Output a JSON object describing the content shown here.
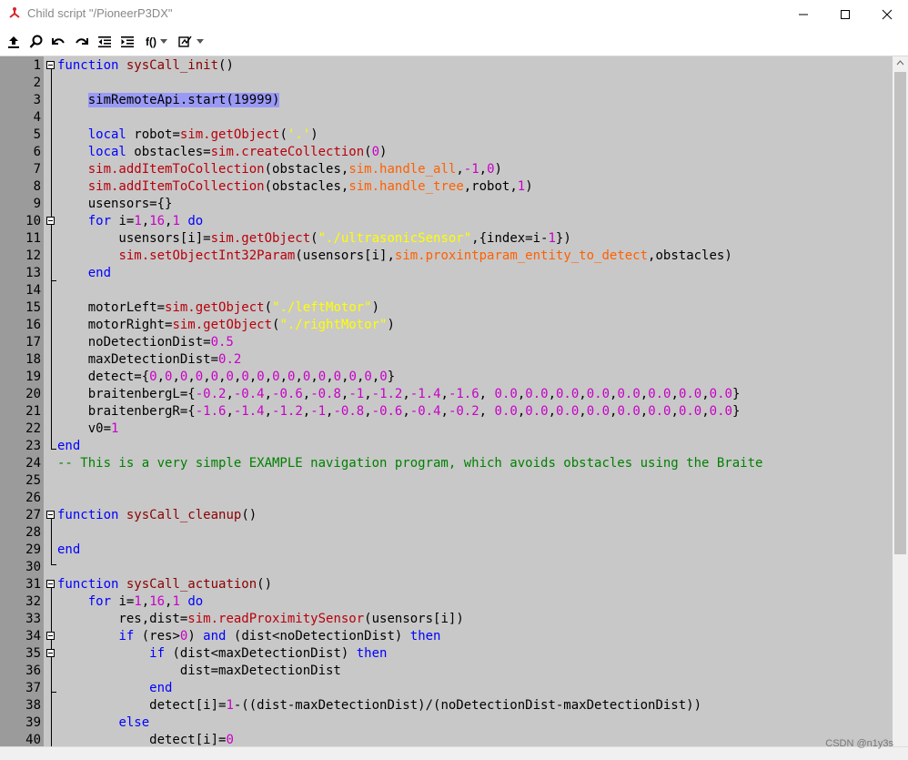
{
  "window": {
    "title": "Child script \"/PioneerP3DX\"",
    "accent_color": "#d8262a"
  },
  "toolbar": {
    "function_label": "f()",
    "items": [
      "upload-icon",
      "search-icon",
      "undo-icon",
      "redo-icon",
      "outdent-icon",
      "indent-icon",
      "function-menu",
      "snippet-menu"
    ]
  },
  "colors": {
    "keyword": "#0000ff",
    "function": "#8b0000",
    "api": "#b8000b",
    "number": "#c800c8",
    "string": "#ffff00",
    "constant": "#ff6000",
    "comment": "#008000",
    "selection": "#9a9af6",
    "gutter": "#9b9b9b",
    "background": "#c8c8c8"
  },
  "lines": [
    {
      "n": "1",
      "tokens": [
        {
          "t": "function",
          "c": "keyword"
        },
        {
          "t": " ",
          "c": "plain"
        },
        {
          "t": "sysCall_init",
          "c": "function"
        },
        {
          "t": "()",
          "c": "plain"
        }
      ]
    },
    {
      "n": "2",
      "tokens": []
    },
    {
      "n": "3",
      "tokens": [
        {
          "t": "    ",
          "c": "plain"
        },
        {
          "t": "simRemoteApi.start(19999)",
          "c": "selected"
        }
      ]
    },
    {
      "n": "4",
      "tokens": []
    },
    {
      "n": "5",
      "tokens": [
        {
          "t": "    ",
          "c": "plain"
        },
        {
          "t": "local",
          "c": "keyword"
        },
        {
          "t": " robot=",
          "c": "plain"
        },
        {
          "t": "sim.getObject",
          "c": "api"
        },
        {
          "t": "(",
          "c": "plain"
        },
        {
          "t": "'.'",
          "c": "string"
        },
        {
          "t": ")",
          "c": "plain"
        }
      ]
    },
    {
      "n": "6",
      "tokens": [
        {
          "t": "    ",
          "c": "plain"
        },
        {
          "t": "local",
          "c": "keyword"
        },
        {
          "t": " obstacles=",
          "c": "plain"
        },
        {
          "t": "sim.createCollection",
          "c": "api"
        },
        {
          "t": "(",
          "c": "plain"
        },
        {
          "t": "0",
          "c": "number"
        },
        {
          "t": ")",
          "c": "plain"
        }
      ]
    },
    {
      "n": "7",
      "tokens": [
        {
          "t": "    ",
          "c": "plain"
        },
        {
          "t": "sim.addItemToCollection",
          "c": "api"
        },
        {
          "t": "(obstacles,",
          "c": "plain"
        },
        {
          "t": "sim.handle_all",
          "c": "constant"
        },
        {
          "t": ",",
          "c": "plain"
        },
        {
          "t": "-1",
          "c": "number"
        },
        {
          "t": ",",
          "c": "plain"
        },
        {
          "t": "0",
          "c": "number"
        },
        {
          "t": ")",
          "c": "plain"
        }
      ]
    },
    {
      "n": "8",
      "tokens": [
        {
          "t": "    ",
          "c": "plain"
        },
        {
          "t": "sim.addItemToCollection",
          "c": "api"
        },
        {
          "t": "(obstacles,",
          "c": "plain"
        },
        {
          "t": "sim.handle_tree",
          "c": "constant"
        },
        {
          "t": ",robot,",
          "c": "plain"
        },
        {
          "t": "1",
          "c": "number"
        },
        {
          "t": ")",
          "c": "plain"
        }
      ]
    },
    {
      "n": "9",
      "tokens": [
        {
          "t": "    usensors={}",
          "c": "plain"
        }
      ]
    },
    {
      "n": "10",
      "tokens": [
        {
          "t": "    ",
          "c": "plain"
        },
        {
          "t": "for",
          "c": "keyword"
        },
        {
          "t": " i=",
          "c": "plain"
        },
        {
          "t": "1",
          "c": "number"
        },
        {
          "t": ",",
          "c": "plain"
        },
        {
          "t": "16",
          "c": "number"
        },
        {
          "t": ",",
          "c": "plain"
        },
        {
          "t": "1",
          "c": "number"
        },
        {
          "t": " ",
          "c": "plain"
        },
        {
          "t": "do",
          "c": "keyword"
        }
      ]
    },
    {
      "n": "11",
      "tokens": [
        {
          "t": "        usensors[i]=",
          "c": "plain"
        },
        {
          "t": "sim.getObject",
          "c": "api"
        },
        {
          "t": "(",
          "c": "plain"
        },
        {
          "t": "\"./ultrasonicSensor\"",
          "c": "string"
        },
        {
          "t": ",{index=i-",
          "c": "plain"
        },
        {
          "t": "1",
          "c": "number"
        },
        {
          "t": "})",
          "c": "plain"
        }
      ]
    },
    {
      "n": "12",
      "tokens": [
        {
          "t": "        ",
          "c": "plain"
        },
        {
          "t": "sim.setObjectInt32Param",
          "c": "api"
        },
        {
          "t": "(usensors[i],",
          "c": "plain"
        },
        {
          "t": "sim.proxintparam_entity_to_detect",
          "c": "constant"
        },
        {
          "t": ",obstacles)",
          "c": "plain"
        }
      ]
    },
    {
      "n": "13",
      "tokens": [
        {
          "t": "    ",
          "c": "plain"
        },
        {
          "t": "end",
          "c": "keyword"
        }
      ]
    },
    {
      "n": "14",
      "tokens": []
    },
    {
      "n": "15",
      "tokens": [
        {
          "t": "    motorLeft=",
          "c": "plain"
        },
        {
          "t": "sim.getObject",
          "c": "api"
        },
        {
          "t": "(",
          "c": "plain"
        },
        {
          "t": "\"./leftMotor\"",
          "c": "string"
        },
        {
          "t": ")",
          "c": "plain"
        }
      ]
    },
    {
      "n": "16",
      "tokens": [
        {
          "t": "    motorRight=",
          "c": "plain"
        },
        {
          "t": "sim.getObject",
          "c": "api"
        },
        {
          "t": "(",
          "c": "plain"
        },
        {
          "t": "\"./rightMotor\"",
          "c": "string"
        },
        {
          "t": ")",
          "c": "plain"
        }
      ]
    },
    {
      "n": "17",
      "tokens": [
        {
          "t": "    noDetectionDist=",
          "c": "plain"
        },
        {
          "t": "0.5",
          "c": "number"
        }
      ]
    },
    {
      "n": "18",
      "tokens": [
        {
          "t": "    maxDetectionDist=",
          "c": "plain"
        },
        {
          "t": "0.2",
          "c": "number"
        }
      ]
    },
    {
      "n": "19",
      "tokens": [
        {
          "t": "    detect={",
          "c": "plain"
        },
        {
          "t": "0",
          "c": "number"
        },
        {
          "t": ",",
          "c": "plain"
        },
        {
          "t": "0",
          "c": "number"
        },
        {
          "t": ",",
          "c": "plain"
        },
        {
          "t": "0",
          "c": "number"
        },
        {
          "t": ",",
          "c": "plain"
        },
        {
          "t": "0",
          "c": "number"
        },
        {
          "t": ",",
          "c": "plain"
        },
        {
          "t": "0",
          "c": "number"
        },
        {
          "t": ",",
          "c": "plain"
        },
        {
          "t": "0",
          "c": "number"
        },
        {
          "t": ",",
          "c": "plain"
        },
        {
          "t": "0",
          "c": "number"
        },
        {
          "t": ",",
          "c": "plain"
        },
        {
          "t": "0",
          "c": "number"
        },
        {
          "t": ",",
          "c": "plain"
        },
        {
          "t": "0",
          "c": "number"
        },
        {
          "t": ",",
          "c": "plain"
        },
        {
          "t": "0",
          "c": "number"
        },
        {
          "t": ",",
          "c": "plain"
        },
        {
          "t": "0",
          "c": "number"
        },
        {
          "t": ",",
          "c": "plain"
        },
        {
          "t": "0",
          "c": "number"
        },
        {
          "t": ",",
          "c": "plain"
        },
        {
          "t": "0",
          "c": "number"
        },
        {
          "t": ",",
          "c": "plain"
        },
        {
          "t": "0",
          "c": "number"
        },
        {
          "t": ",",
          "c": "plain"
        },
        {
          "t": "0",
          "c": "number"
        },
        {
          "t": ",",
          "c": "plain"
        },
        {
          "t": "0",
          "c": "number"
        },
        {
          "t": "}",
          "c": "plain"
        }
      ]
    },
    {
      "n": "20",
      "tokens": [
        {
          "t": "    braitenbergL={",
          "c": "plain"
        },
        {
          "t": "-0.2",
          "c": "number"
        },
        {
          "t": ",",
          "c": "plain"
        },
        {
          "t": "-0.4",
          "c": "number"
        },
        {
          "t": ",",
          "c": "plain"
        },
        {
          "t": "-0.6",
          "c": "number"
        },
        {
          "t": ",",
          "c": "plain"
        },
        {
          "t": "-0.8",
          "c": "number"
        },
        {
          "t": ",",
          "c": "plain"
        },
        {
          "t": "-1",
          "c": "number"
        },
        {
          "t": ",",
          "c": "plain"
        },
        {
          "t": "-1.2",
          "c": "number"
        },
        {
          "t": ",",
          "c": "plain"
        },
        {
          "t": "-1.4",
          "c": "number"
        },
        {
          "t": ",",
          "c": "plain"
        },
        {
          "t": "-1.6",
          "c": "number"
        },
        {
          "t": ", ",
          "c": "plain"
        },
        {
          "t": "0.0",
          "c": "number"
        },
        {
          "t": ",",
          "c": "plain"
        },
        {
          "t": "0.0",
          "c": "number"
        },
        {
          "t": ",",
          "c": "plain"
        },
        {
          "t": "0.0",
          "c": "number"
        },
        {
          "t": ",",
          "c": "plain"
        },
        {
          "t": "0.0",
          "c": "number"
        },
        {
          "t": ",",
          "c": "plain"
        },
        {
          "t": "0.0",
          "c": "number"
        },
        {
          "t": ",",
          "c": "plain"
        },
        {
          "t": "0.0",
          "c": "number"
        },
        {
          "t": ",",
          "c": "plain"
        },
        {
          "t": "0.0",
          "c": "number"
        },
        {
          "t": ",",
          "c": "plain"
        },
        {
          "t": "0.0",
          "c": "number"
        },
        {
          "t": "}",
          "c": "plain"
        }
      ]
    },
    {
      "n": "21",
      "tokens": [
        {
          "t": "    braitenbergR={",
          "c": "plain"
        },
        {
          "t": "-1.6",
          "c": "number"
        },
        {
          "t": ",",
          "c": "plain"
        },
        {
          "t": "-1.4",
          "c": "number"
        },
        {
          "t": ",",
          "c": "plain"
        },
        {
          "t": "-1.2",
          "c": "number"
        },
        {
          "t": ",",
          "c": "plain"
        },
        {
          "t": "-1",
          "c": "number"
        },
        {
          "t": ",",
          "c": "plain"
        },
        {
          "t": "-0.8",
          "c": "number"
        },
        {
          "t": ",",
          "c": "plain"
        },
        {
          "t": "-0.6",
          "c": "number"
        },
        {
          "t": ",",
          "c": "plain"
        },
        {
          "t": "-0.4",
          "c": "number"
        },
        {
          "t": ",",
          "c": "plain"
        },
        {
          "t": "-0.2",
          "c": "number"
        },
        {
          "t": ", ",
          "c": "plain"
        },
        {
          "t": "0.0",
          "c": "number"
        },
        {
          "t": ",",
          "c": "plain"
        },
        {
          "t": "0.0",
          "c": "number"
        },
        {
          "t": ",",
          "c": "plain"
        },
        {
          "t": "0.0",
          "c": "number"
        },
        {
          "t": ",",
          "c": "plain"
        },
        {
          "t": "0.0",
          "c": "number"
        },
        {
          "t": ",",
          "c": "plain"
        },
        {
          "t": "0.0",
          "c": "number"
        },
        {
          "t": ",",
          "c": "plain"
        },
        {
          "t": "0.0",
          "c": "number"
        },
        {
          "t": ",",
          "c": "plain"
        },
        {
          "t": "0.0",
          "c": "number"
        },
        {
          "t": ",",
          "c": "plain"
        },
        {
          "t": "0.0",
          "c": "number"
        },
        {
          "t": "}",
          "c": "plain"
        }
      ]
    },
    {
      "n": "22",
      "tokens": [
        {
          "t": "    v0=",
          "c": "plain"
        },
        {
          "t": "1",
          "c": "number"
        }
      ]
    },
    {
      "n": "23",
      "tokens": [
        {
          "t": "end",
          "c": "keyword"
        }
      ]
    },
    {
      "n": "24",
      "tokens": [
        {
          "t": "-- This is a very simple EXAMPLE navigation program, which avoids obstacles using the Braite",
          "c": "comment"
        }
      ]
    },
    {
      "n": "25",
      "tokens": []
    },
    {
      "n": "26",
      "tokens": []
    },
    {
      "n": "27",
      "tokens": [
        {
          "t": "function",
          "c": "keyword"
        },
        {
          "t": " ",
          "c": "plain"
        },
        {
          "t": "sysCall_cleanup",
          "c": "function"
        },
        {
          "t": "()",
          "c": "plain"
        }
      ]
    },
    {
      "n": "28",
      "tokens": []
    },
    {
      "n": "29",
      "tokens": [
        {
          "t": "end",
          "c": "keyword"
        }
      ]
    },
    {
      "n": "30",
      "tokens": []
    },
    {
      "n": "31",
      "tokens": [
        {
          "t": "function",
          "c": "keyword"
        },
        {
          "t": " ",
          "c": "plain"
        },
        {
          "t": "sysCall_actuation",
          "c": "function"
        },
        {
          "t": "()",
          "c": "plain"
        }
      ]
    },
    {
      "n": "32",
      "tokens": [
        {
          "t": "    ",
          "c": "plain"
        },
        {
          "t": "for",
          "c": "keyword"
        },
        {
          "t": " i=",
          "c": "plain"
        },
        {
          "t": "1",
          "c": "number"
        },
        {
          "t": ",",
          "c": "plain"
        },
        {
          "t": "16",
          "c": "number"
        },
        {
          "t": ",",
          "c": "plain"
        },
        {
          "t": "1",
          "c": "number"
        },
        {
          "t": " ",
          "c": "plain"
        },
        {
          "t": "do",
          "c": "keyword"
        }
      ]
    },
    {
      "n": "33",
      "tokens": [
        {
          "t": "        res,dist=",
          "c": "plain"
        },
        {
          "t": "sim.readProximitySensor",
          "c": "api"
        },
        {
          "t": "(usensors[i])",
          "c": "plain"
        }
      ]
    },
    {
      "n": "34",
      "tokens": [
        {
          "t": "        ",
          "c": "plain"
        },
        {
          "t": "if",
          "c": "keyword"
        },
        {
          "t": " (res>",
          "c": "plain"
        },
        {
          "t": "0",
          "c": "number"
        },
        {
          "t": ") ",
          "c": "plain"
        },
        {
          "t": "and",
          "c": "keyword"
        },
        {
          "t": " (dist<noDetectionDist) ",
          "c": "plain"
        },
        {
          "t": "then",
          "c": "keyword"
        }
      ]
    },
    {
      "n": "35",
      "tokens": [
        {
          "t": "            ",
          "c": "plain"
        },
        {
          "t": "if",
          "c": "keyword"
        },
        {
          "t": " (dist<maxDetectionDist) ",
          "c": "plain"
        },
        {
          "t": "then",
          "c": "keyword"
        }
      ]
    },
    {
      "n": "36",
      "tokens": [
        {
          "t": "                dist=maxDetectionDist",
          "c": "plain"
        }
      ]
    },
    {
      "n": "37",
      "tokens": [
        {
          "t": "            ",
          "c": "plain"
        },
        {
          "t": "end",
          "c": "keyword"
        }
      ]
    },
    {
      "n": "38",
      "tokens": [
        {
          "t": "            detect[i]=",
          "c": "plain"
        },
        {
          "t": "1",
          "c": "number"
        },
        {
          "t": "-((dist-maxDetectionDist)/(noDetectionDist-maxDetectionDist))",
          "c": "plain"
        }
      ]
    },
    {
      "n": "39",
      "tokens": [
        {
          "t": "        ",
          "c": "plain"
        },
        {
          "t": "else",
          "c": "keyword"
        }
      ]
    },
    {
      "n": "40",
      "tokens": [
        {
          "t": "            detect[i]=",
          "c": "plain"
        },
        {
          "t": "0",
          "c": "number"
        }
      ]
    }
  ],
  "watermark": "CSDN @n1y3s"
}
